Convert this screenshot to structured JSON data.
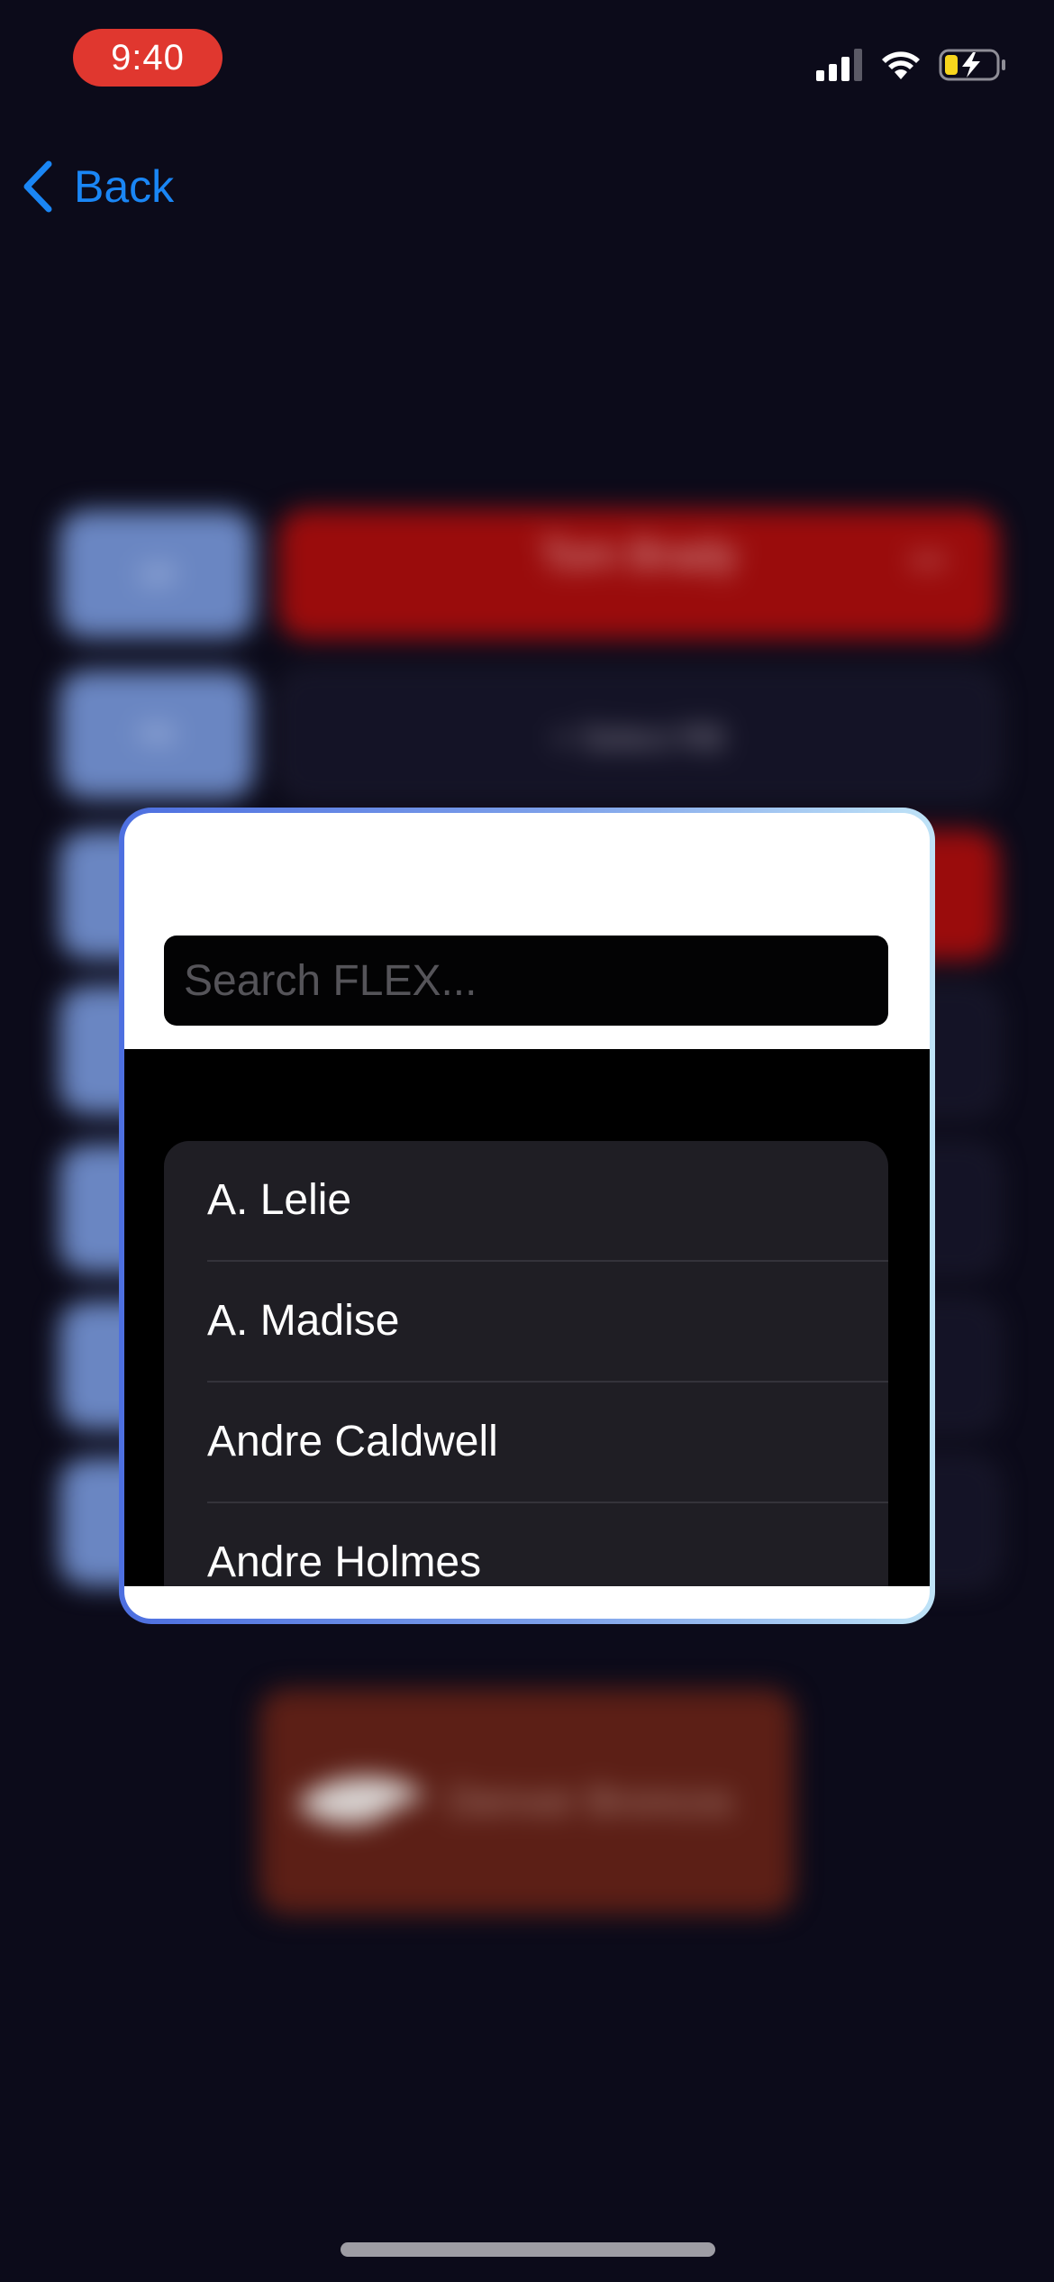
{
  "status_bar": {
    "time": "9:40",
    "time_pill_color": "#e0372f",
    "icons": [
      "cellular-signal-icon",
      "wifi-icon",
      "battery-charging-icon"
    ]
  },
  "nav": {
    "back_label": "Back",
    "accent_color": "#1a86f5"
  },
  "background": {
    "blurred": true,
    "roster_rows": [
      {
        "position": "QB",
        "player": "Tom Brady",
        "score": "0.0",
        "status": "filled"
      },
      {
        "position": "RB",
        "player": "+ Select RB",
        "status": "empty"
      }
    ],
    "team_card": {
      "name": "Denver Broncos",
      "color": "#5c1f16"
    }
  },
  "search": {
    "placeholder": "Search FLEX..."
  },
  "players": [
    "A. Lelie",
    "A. Madise",
    "Andre Caldwell",
    "Andre Holmes"
  ]
}
